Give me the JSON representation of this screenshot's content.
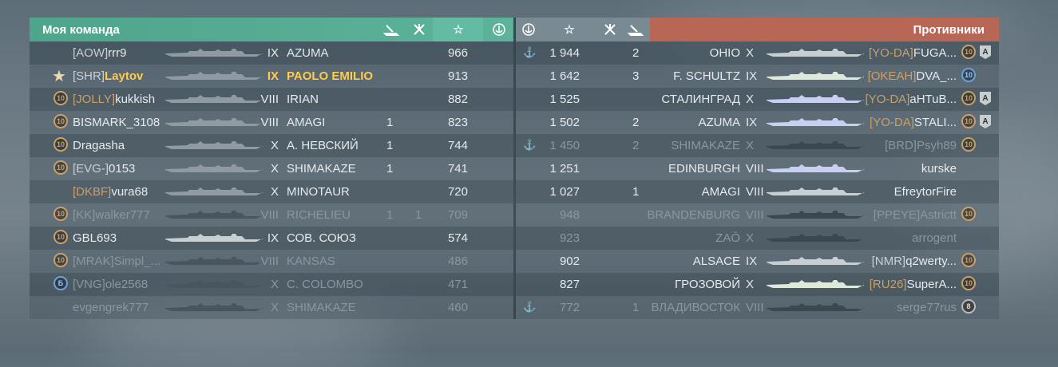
{
  "team": {
    "title": "Моя команда",
    "rows": [
      {
        "badge": "",
        "clan": "[AOW]",
        "clan_color": "grey",
        "name": "rrr9",
        "tier": "IX",
        "ship": "AZUMA",
        "c1": "",
        "c2": "",
        "score": "966",
        "alive": true,
        "self": false,
        "ship_color": "#8f9aa2"
      },
      {
        "badge": "star",
        "clan": "[SHR]",
        "clan_color": "grey",
        "name": "Laytov",
        "tier": "IX",
        "ship": "PAOLO EMILIO",
        "c1": "",
        "c2": "",
        "score": "913",
        "alive": true,
        "self": true,
        "ship_color": "#8f9aa2"
      },
      {
        "badge": "10",
        "clan": "[JOLLY]",
        "clan_color": "orange",
        "name": "kukkish",
        "tier": "VIII",
        "ship": "IRIAN",
        "c1": "",
        "c2": "",
        "score": "882",
        "alive": true,
        "self": false,
        "ship_color": "#8f9aa2"
      },
      {
        "badge": "10",
        "clan": "",
        "clan_color": "grey",
        "name": "BISMARK_3108",
        "tier": "VIII",
        "ship": "AMAGI",
        "c1": "1",
        "c2": "",
        "score": "823",
        "alive": true,
        "self": false,
        "ship_color": "#8f9aa2"
      },
      {
        "badge": "10",
        "clan": "",
        "clan_color": "grey",
        "name": "Dragasha",
        "tier": "X",
        "ship": "А. НЕВСКИЙ",
        "c1": "1",
        "c2": "",
        "score": "744",
        "alive": true,
        "self": false,
        "ship_color": "#8f9aa2"
      },
      {
        "badge": "10",
        "clan": "[EVG-]",
        "clan_color": "grey",
        "name": "0153",
        "tier": "X",
        "ship": "SHIMAKAZE",
        "c1": "1",
        "c2": "",
        "score": "741",
        "alive": true,
        "self": false,
        "ship_color": "#8f9aa2"
      },
      {
        "badge": "",
        "clan": "[DKBF]",
        "clan_color": "orange",
        "name": "vura68",
        "tier": "X",
        "ship": "MINOTAUR",
        "c1": "",
        "c2": "",
        "score": "720",
        "alive": true,
        "self": false,
        "ship_color": "#8f9aa2"
      },
      {
        "badge": "10",
        "clan": "[KK]",
        "clan_color": "grey",
        "name": "walker777",
        "tier": "VIII",
        "ship": "RICHELIEU",
        "c1": "1",
        "c2": "1",
        "score": "709",
        "alive": false,
        "self": false,
        "ship_color": "#4a565e"
      },
      {
        "badge": "10",
        "clan": "",
        "clan_color": "grey",
        "name": "GBL693",
        "tier": "IX",
        "ship": "СОВ. СОЮЗ",
        "c1": "",
        "c2": "",
        "score": "574",
        "alive": true,
        "self": false,
        "ship_color": "#c8cfd3"
      },
      {
        "badge": "10",
        "clan": "[MRAK]",
        "clan_color": "orange",
        "name": "Simpl_...",
        "tier": "VIII",
        "ship": "KANSAS",
        "c1": "",
        "c2": "",
        "score": "486",
        "alive": false,
        "self": false,
        "ship_color": "#4a565e"
      },
      {
        "badge": "Б",
        "clan": "[VNG]",
        "clan_color": "orange",
        "name": "ole2568",
        "tier": "X",
        "ship": "C. COLOMBO",
        "c1": "",
        "c2": "",
        "score": "471",
        "alive": false,
        "self": false,
        "ship_color": "#4a565e"
      },
      {
        "badge": "",
        "clan": "",
        "clan_color": "grey",
        "name": "evgengrek777",
        "tier": "X",
        "ship": "SHIMAKAZE",
        "c1": "",
        "c2": "",
        "score": "460",
        "alive": false,
        "self": false,
        "ship_color": "#4a565e"
      }
    ]
  },
  "enemy": {
    "title": "Противники",
    "rows": [
      {
        "anchor": true,
        "score": "1 944",
        "c1": "2",
        "c2": "",
        "ship": "OHIO",
        "tier": "X",
        "clan": "[YO-DA]",
        "clan_color": "orange",
        "name": "FUGA...",
        "badge": "10",
        "rank": "A",
        "alive": true,
        "ship_color": "#c8cfd3"
      },
      {
        "anchor": false,
        "score": "1 642",
        "c1": "3",
        "c2": "",
        "ship": "F. SCHULTZ",
        "tier": "IX",
        "clan": "[OKEAH]",
        "clan_color": "orange",
        "name": "DVA_...",
        "badge": "10b",
        "rank": "",
        "alive": true,
        "ship_color": "#dfe9d9"
      },
      {
        "anchor": false,
        "score": "1 525",
        "c1": "",
        "c2": "",
        "ship": "СТАЛИНГРАД",
        "tier": "X",
        "clan": "[YO-DA]",
        "clan_color": "orange",
        "name": "aHTuB...",
        "badge": "10",
        "rank": "A",
        "alive": true,
        "ship_color": "#c9cff0"
      },
      {
        "anchor": false,
        "score": "1 502",
        "c1": "2",
        "c2": "",
        "ship": "AZUMA",
        "tier": "IX",
        "clan": "[YO-DA]",
        "clan_color": "orange",
        "name": "STALI...",
        "badge": "10",
        "rank": "A",
        "alive": true,
        "ship_color": "#c9cff0"
      },
      {
        "anchor": true,
        "score": "1 450",
        "c1": "2",
        "c2": "",
        "ship": "SHIMAKAZE",
        "tier": "X",
        "clan": "[BRD]",
        "clan_color": "orange",
        "name": "Psyh89",
        "badge": "10",
        "rank": "",
        "alive": false,
        "ship_color": "#3c4850"
      },
      {
        "anchor": false,
        "score": "1 251",
        "c1": "",
        "c2": "",
        "ship": "EDINBURGH",
        "tier": "VIII",
        "clan": "",
        "clan_color": "grey",
        "name": "kurske",
        "badge": "",
        "rank": "",
        "alive": true,
        "ship_color": "#c9cff0"
      },
      {
        "anchor": false,
        "score": "1 027",
        "c1": "1",
        "c2": "",
        "ship": "AMAGI",
        "tier": "VIII",
        "clan": "",
        "clan_color": "grey",
        "name": "EfreytorFire",
        "badge": "",
        "rank": "",
        "alive": true,
        "ship_color": "#c8cfd3"
      },
      {
        "anchor": false,
        "score": "948",
        "c1": "",
        "c2": "",
        "ship": "BRANDENBURG",
        "tier": "VIII",
        "clan": "[PPEYE]",
        "clan_color": "green",
        "name": "Astrictt",
        "badge": "10",
        "rank": "",
        "alive": false,
        "ship_color": "#3c4850"
      },
      {
        "anchor": false,
        "score": "923",
        "c1": "",
        "c2": "",
        "ship": "ZAŌ",
        "tier": "X",
        "clan": "",
        "clan_color": "grey",
        "name": "arrogent",
        "badge": "",
        "rank": "",
        "alive": false,
        "ship_color": "#3c4850"
      },
      {
        "anchor": false,
        "score": "902",
        "c1": "",
        "c2": "",
        "ship": "ALSACE",
        "tier": "IX",
        "clan": "[NMR]",
        "clan_color": "grey",
        "name": "q2werty...",
        "badge": "10",
        "rank": "",
        "alive": true,
        "ship_color": "#c8cfd3"
      },
      {
        "anchor": false,
        "score": "827",
        "c1": "",
        "c2": "",
        "ship": "ГРОЗОВОЙ",
        "tier": "X",
        "clan": "[RU26]",
        "clan_color": "orange",
        "name": "SuperA...",
        "badge": "10",
        "rank": "",
        "alive": true,
        "ship_color": "#dfe9d9"
      },
      {
        "anchor": true,
        "score": "772",
        "c1": "1",
        "c2": "",
        "ship": "ВЛАДИВОСТОК",
        "tier": "VIII",
        "clan": "",
        "clan_color": "grey",
        "name": "serge77rus",
        "badge": "8",
        "rank": "",
        "alive": false,
        "ship_color": "#3c4850"
      }
    ]
  },
  "icons": {
    "torpedo": "torpedo-icon",
    "planes": "plane-kill-icon",
    "star": "star-icon",
    "anchor": "anchor-icon"
  }
}
